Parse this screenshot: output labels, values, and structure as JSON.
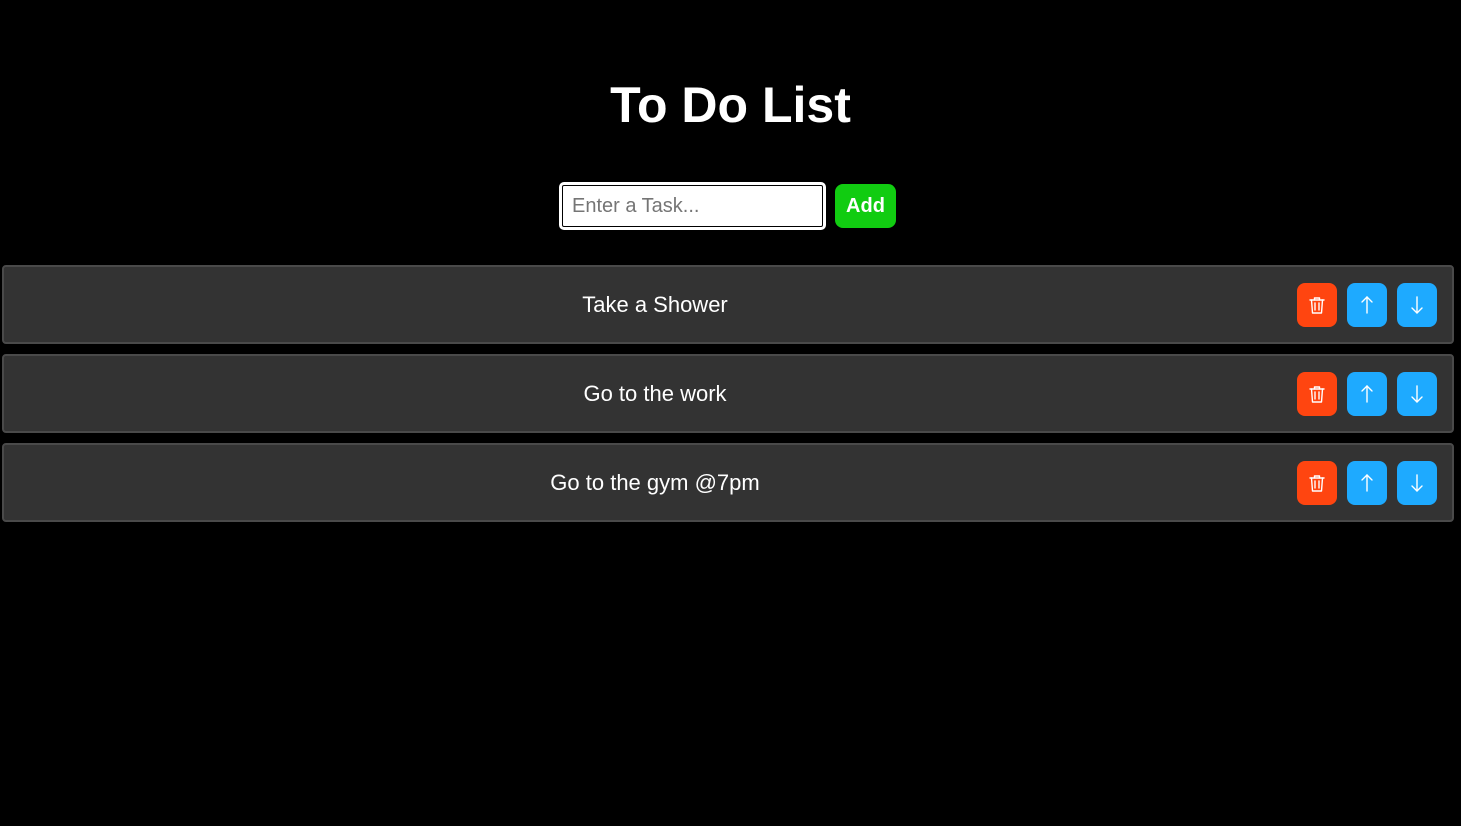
{
  "title": "To Do List",
  "input": {
    "placeholder": "Enter a Task...",
    "value": ""
  },
  "add_label": "Add",
  "tasks": [
    {
      "text": "Take a Shower"
    },
    {
      "text": "Go to the work"
    },
    {
      "text": "Go to the gym @7pm"
    }
  ],
  "icons": {
    "delete": "trash-icon",
    "up": "arrow-up-icon",
    "down": "arrow-down-icon"
  },
  "colors": {
    "background": "#000000",
    "task_bg": "#333333",
    "add_button": "#11cc11",
    "delete_button": "#ff4510",
    "move_button": "#1eaaff"
  }
}
